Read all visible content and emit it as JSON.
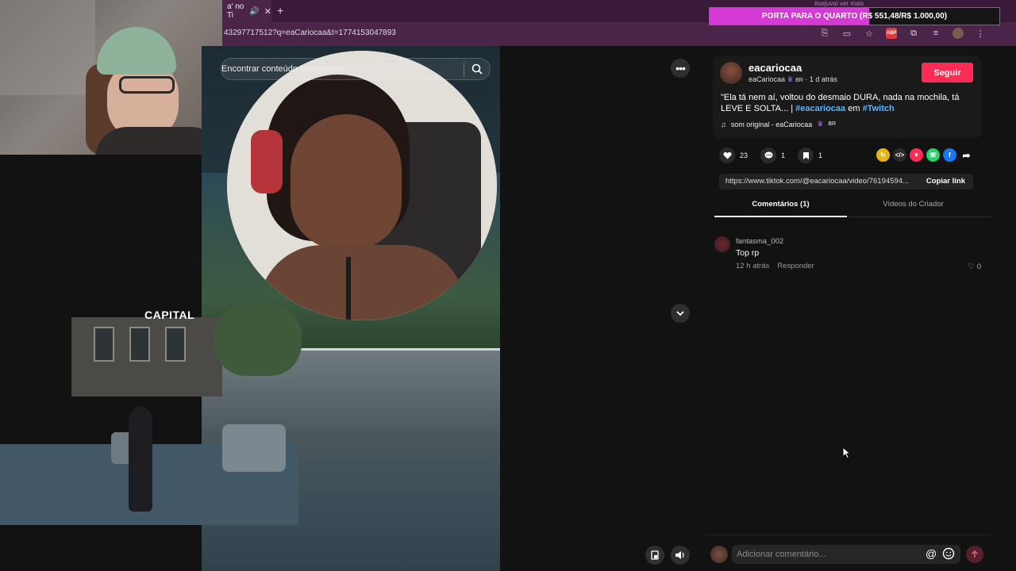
{
  "browser": {
    "tab_title": "a' no Ti",
    "url": "43297717512?q=eaCariocaa&t=1774153047893"
  },
  "overlay": {
    "goal_top": "#sejuvaí ver mais",
    "goal_text": "PORTA PARA O QUARTO (R$ 551,48/R$ 1.000,00)",
    "goal_progress": 0.5515,
    "goal_color": "#d63ad4"
  },
  "video": {
    "search_placeholder": "Encontrar conteúdo relacionado",
    "watermark": "CAPITAL"
  },
  "post": {
    "username": "eacariocaa",
    "display_name": "eaCariocaa",
    "badge": "BR",
    "posted": "· 1 d atrás",
    "follow_label": "Seguir",
    "caption_text": "\"Ela tá nem aí, voltou do desmaio DURA, nada na mochila, tá LEVE E SOLTA... |",
    "tag1": "#eacariocaa",
    "caption_mid": "em",
    "tag2": "#Twitch",
    "sound": "som original - eaCariocaa",
    "likes": "23",
    "comments": "1",
    "saves": "1",
    "link": "https://www.tiktok.com/@eacariocaa/video/76194594...",
    "copy_label": "Copiar link",
    "accent": "#fe2c55"
  },
  "tabs": {
    "comments": "Comentários (1)",
    "creator": "Vídeos do Criador"
  },
  "comment": {
    "user": "fantasma_002",
    "text": "Top rp",
    "time": "12 h atrás",
    "reply": "Responder",
    "likes": "0"
  },
  "compose": {
    "placeholder": "Adicionar comentário...",
    "at": "@"
  }
}
